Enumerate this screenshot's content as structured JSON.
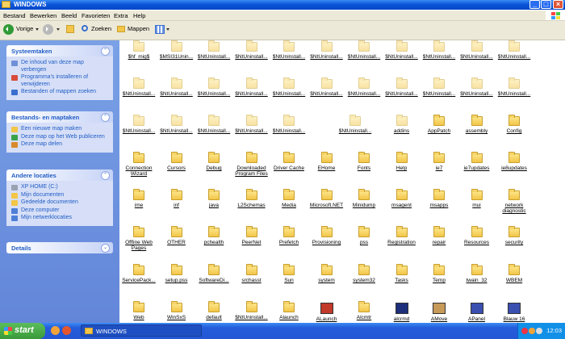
{
  "window": {
    "title": "WINDOWS",
    "min_label": "_",
    "max_label": "□",
    "close_label": "×"
  },
  "menu": [
    "Bestand",
    "Bewerken",
    "Beeld",
    "Favorieten",
    "Extra",
    "Help"
  ],
  "toolbar": {
    "back_label": "Vorige",
    "search_label": "Zoeken",
    "folders_label": "Mappen"
  },
  "sidebar": {
    "panels": [
      {
        "title": "Systeemtaken",
        "items": [
          {
            "label": "De inhoud van deze map verbergen",
            "icon": "view-icon"
          },
          {
            "label": "Programma's installeren of verwijderen",
            "icon": "install-icon"
          },
          {
            "label": "Bestanden of mappen zoeken",
            "icon": "search-icon"
          }
        ]
      },
      {
        "title": "Bestands- en maptaken",
        "items": [
          {
            "label": "Een nieuwe map maken",
            "icon": "new-folder-icon"
          },
          {
            "label": "Deze map op het Web publiceren",
            "icon": "web-publish-icon"
          },
          {
            "label": "Deze map delen",
            "icon": "share-icon"
          }
        ]
      },
      {
        "title": "Andere locaties",
        "items": [
          {
            "label": "XP HOME (C:)",
            "icon": "drive-icon"
          },
          {
            "label": "Mijn documenten",
            "icon": "documents-icon"
          },
          {
            "label": "Gedeelde documenten",
            "icon": "shared-documents-icon"
          },
          {
            "label": "Deze computer",
            "icon": "computer-icon"
          },
          {
            "label": "Mijn netwerklocaties",
            "icon": "network-icon"
          }
        ]
      },
      {
        "title": "Details",
        "items": []
      }
    ]
  },
  "files": [
    "$hf_mig$",
    "$MSI31Unin...",
    "$NtUninstall...",
    "$NtUninstall...",
    "$NtUninstall...",
    "$NtUninstall...",
    "$NtUninstall...",
    "$NtUninstall...",
    "$NtUninstall...",
    "$NtUninstall...",
    "$NtUninstall...",
    "$NtUninstall...",
    "$NtUninstall...",
    "$NtUninstall...",
    "$NtUninstall...",
    "$NtUninstall...",
    "$NtUninstall...",
    "$NtUninstall...",
    "$NtUninstall...",
    "$NtUninstall...",
    "$NtUninstall...",
    "$NtUninstall...",
    "$NtUninstall...",
    "$NtUninstall...",
    "$NtUninstall...",
    "$NtUninstall...",
    "$NtUninstall...",
    "$NtUninstall...",
    "addins",
    "AppPatch",
    "assembly",
    "Config",
    "Connection Wizard",
    "Cursors",
    "Debug",
    "Downloaded Program Files",
    "Driver Cache",
    "EHome",
    "Fonts",
    "Help",
    "ie7",
    "ie7updates",
    "ie8updates",
    "ime",
    "inf",
    "java",
    "L2Schemas",
    "Media",
    "Microsoft.NET",
    "Minidump",
    "msagent",
    "msapps",
    "mui",
    "network diagnostic",
    "Offline Web Pages",
    "OTHER",
    "pchealth",
    "PeerNet",
    "Prefetch",
    "Provisioning",
    "pss",
    "Registration",
    "repair",
    "Resources",
    "security",
    "ServicePack...",
    "setup.pss",
    "SoftwareDi...",
    "srchasst",
    "Sun",
    "system",
    "system32",
    "Tasks",
    "Temp",
    "twain_32",
    "WBEM",
    "Web",
    "WinSxS",
    "default",
    "$NtUninstall...",
    "Alaunch",
    "ALaunch",
    "Alcmtr",
    "alcrmd",
    "AMove",
    "APanel",
    "Blauw 16"
  ],
  "taskbar": {
    "start_label": "start",
    "task_label": "WINDOWS",
    "clock": "12:03"
  }
}
